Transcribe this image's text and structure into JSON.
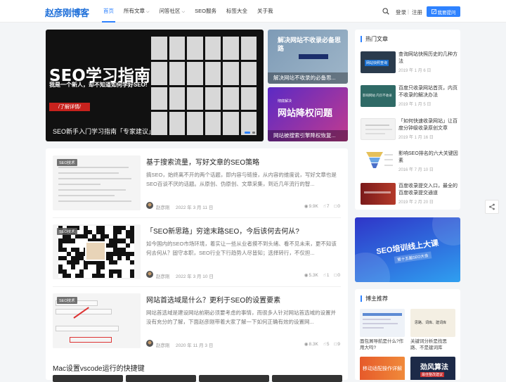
{
  "header": {
    "logo": "赵彦刚博客",
    "nav": [
      {
        "label": "首页",
        "active": true,
        "caret": false
      },
      {
        "label": "所有文章",
        "active": false,
        "caret": true
      },
      {
        "label": "问答社区",
        "active": false,
        "caret": true
      },
      {
        "label": "SEO服务",
        "active": false,
        "caret": false
      },
      {
        "label": "标签大全",
        "active": false,
        "caret": false
      },
      {
        "label": "关于我",
        "active": false,
        "caret": false
      }
    ],
    "login": "登录",
    "separator": "|",
    "register": "注册",
    "submit": "我要提问",
    "accent": "#2e82ff"
  },
  "hero": {
    "image_title": "SEO学习指南",
    "image_sub": "我是一个新人，却不知道如何学好SEO!",
    "image_cta": "了解详情",
    "caption": "SEO新手入门学习指南「专家建议」"
  },
  "side_cards": [
    {
      "image_text": "解决网站不收录必备思路",
      "caption": "解决网站不收录的必备思..."
    },
    {
      "image_small": "彻底解决",
      "image_text": "网站降权问题",
      "caption": "网站被搜索引擎降权恢复..."
    }
  ],
  "articles": [
    {
      "tag": "SEO技术",
      "title": "基于搜索流量，写好文章的SEO策略",
      "desc": "搞SEO，始终离不开的两个话题，即内容与链接，从内容的维度说，写好文章也是SEO百谈不厌的话题。从原创、伪原创、文章采集，到近几年流行的智...",
      "author": "赵彦刚",
      "date": "2022 年 3 月 11 日",
      "views": "9.9K",
      "likes": "7",
      "comments": "0"
    },
    {
      "tag": "SEO技术",
      "title": "「SEO新思路」穷途末路SEO，今后该何去何从?",
      "desc": "如今国内的SEO市场环境，着实让一些从业者摸不到头绪、看不见未来，更不知该何去何从？固守本职，SEO行业下行趋势人尽皆知；选择转行，不仅担...",
      "author": "赵彦刚",
      "date": "2022 年 3 月 10 日",
      "views": "5.3K",
      "likes": "1",
      "comments": "0"
    },
    {
      "tag": "SEO技术",
      "title": "网站首选域是什么？更利于SEO的设置要素",
      "desc": "网站首选域是建设网站前期必须要考虑的事情，而很多人针对网站首选域的设置并没有充分的了解，下面赵彦刚带着大家了解一下如何正确有效的设置网...",
      "author": "赵彦刚",
      "date": "2020 年 11 月 3 日",
      "views": "8.3K",
      "likes": "5",
      "comments": "9"
    }
  ],
  "next_section_title": "Mac设置vscode运行的快捷键",
  "hot": {
    "title": "热门文章",
    "items": [
      {
        "title": "查询网站快照历史的几种方法",
        "date": "2019 年 1 月 6 日",
        "thumb_text": "网站快照查询"
      },
      {
        "title": "百度只收录网站首页，内页不收录的解决办法",
        "date": "2019 年 1 月 5 日",
        "thumb_text": "影响网站 内页不收录"
      },
      {
        "title": "「如何快速收录网站」让百度分钟级收录原创文章",
        "date": "2019 年 1 月 16 日",
        "thumb_text": ""
      },
      {
        "title": "影响SEO排名的六大关键因素",
        "date": "2016 年 7 月 10 日",
        "thumb_text": ""
      },
      {
        "title": "百度收录提交入口，最全的百度收录提交通道",
        "date": "2019 年 2 月 20 日",
        "thumb_text": ""
      }
    ]
  },
  "banner": {
    "title": "SEO培训线上大课",
    "sub": "第十五届SEO大会"
  },
  "owner": {
    "title": "博主推荐",
    "items": [
      {
        "caption": "面包屑导航是什么?作用大吗?"
      },
      {
        "caption": "关键词分析是找思路、不是建词库",
        "thumb_text": "思路、词库、建词库"
      },
      {
        "caption": "",
        "thumb_text": "移动适配操作详解"
      },
      {
        "caption": "",
        "thumb_text": "劲风算法",
        "thumb_sub": "最佳整改建议"
      }
    ]
  }
}
